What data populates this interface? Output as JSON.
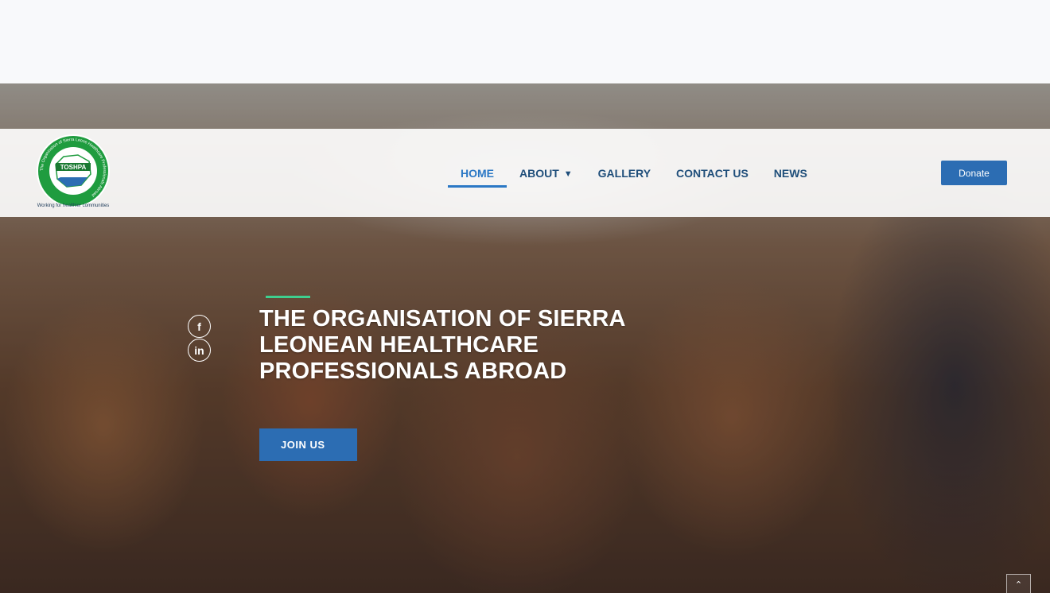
{
  "logo": {
    "abbr": "TOSHPA",
    "ring_text": "The Organisation of Sierra Leone Healthcare Professionals Abroad",
    "tagline": "Working for healthier communities"
  },
  "nav": {
    "items": [
      {
        "label": "HOME",
        "active": true
      },
      {
        "label": "ABOUT",
        "has_dropdown": true
      },
      {
        "label": "GALLERY"
      },
      {
        "label": "CONTACT US"
      },
      {
        "label": "NEWS"
      }
    ],
    "dropdown_icon": "chevron-down-icon"
  },
  "donate": {
    "label": "Donate"
  },
  "social": [
    {
      "icon": "facebook-icon",
      "glyph": "f"
    },
    {
      "icon": "linkedin-icon",
      "glyph": "in"
    }
  ],
  "hero": {
    "title": "THE ORGANISATION OF SIERRA LEONEAN HEALTHCARE PROFESSIONALS ABROAD",
    "cta": "JOIN US"
  },
  "scroll_top": {
    "icon": "chevron-up-icon",
    "glyph": "⌃"
  },
  "colors": {
    "primary": "#2c6db3",
    "nav_text": "#1f4e7a",
    "nav_active": "#2b78c5",
    "accent": "#3ecf8e"
  }
}
